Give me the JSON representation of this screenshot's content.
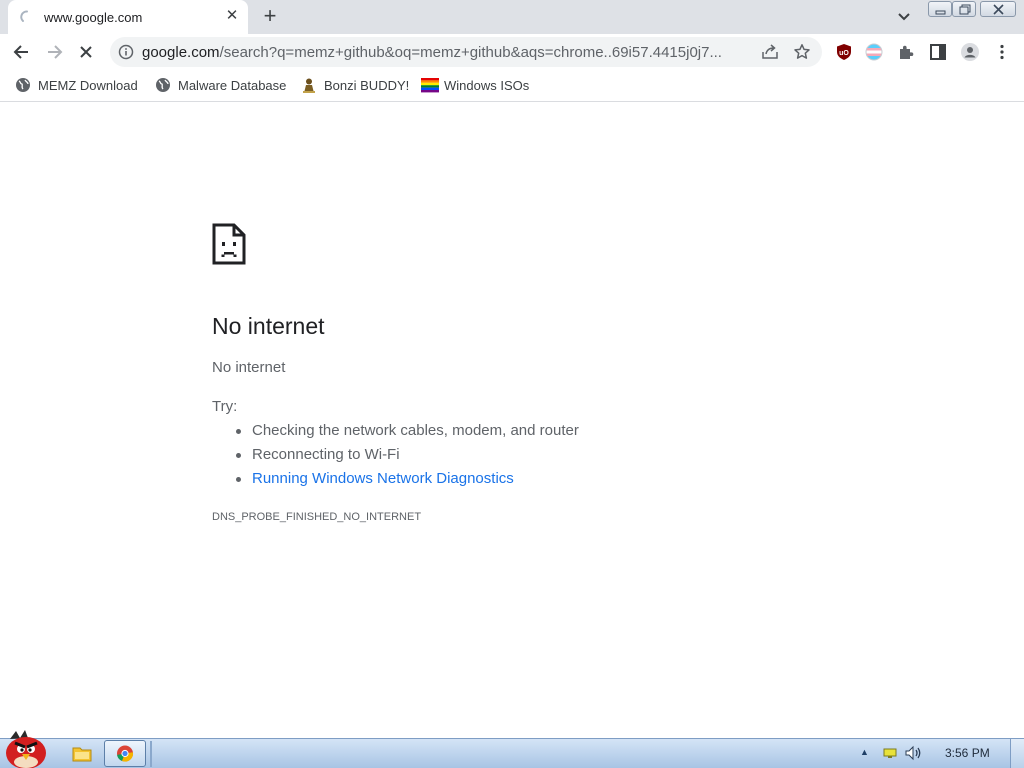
{
  "tab": {
    "title": "www.google.com",
    "close_glyph": "✕"
  },
  "toolbar": {
    "new_tab_glyph": "+",
    "url_host": "google.com",
    "url_path": "/search?q=memz+github&oq=memz+github&aqs=chrome..69i57.4415j0j7..."
  },
  "bookmarks": [
    {
      "label": "MEMZ Download",
      "icon": "globe-icon"
    },
    {
      "label": "Malware Database",
      "icon": "globe-icon"
    },
    {
      "label": "Bonzi BUDDY!",
      "icon": "bonzi-icon"
    },
    {
      "label": "Windows ISOs",
      "icon": "rainbow-flag-icon"
    }
  ],
  "error": {
    "heading": "No internet",
    "subtitle": "No internet",
    "try_label": "Try:",
    "suggestions": [
      "Checking the network cables, modem, and router",
      "Reconnecting to Wi-Fi",
      "Running Windows Network Diagnostics"
    ],
    "code": "DNS_PROBE_FINISHED_NO_INTERNET"
  },
  "taskbar": {
    "tray_arrow": "▲",
    "clock": "3:56 PM"
  },
  "colors": {
    "link": "#1a73e8",
    "tabstrip": "#dee1e6",
    "taskbar": "#b7cde8"
  }
}
